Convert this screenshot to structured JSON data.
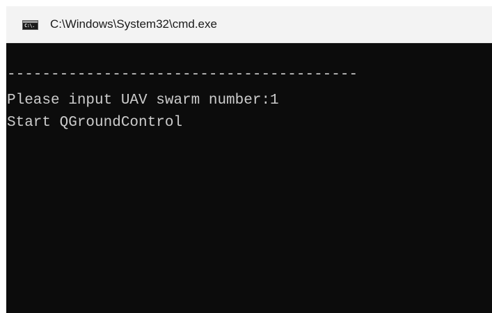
{
  "window": {
    "title": "C:\\Windows\\System32\\cmd.exe",
    "icon": "cmd-icon",
    "icon_glyph": "C:\\."
  },
  "console": {
    "lines": [
      "----------------------------------------",
      "Please input UAV swarm number:1",
      "Start QGroundControl"
    ]
  }
}
